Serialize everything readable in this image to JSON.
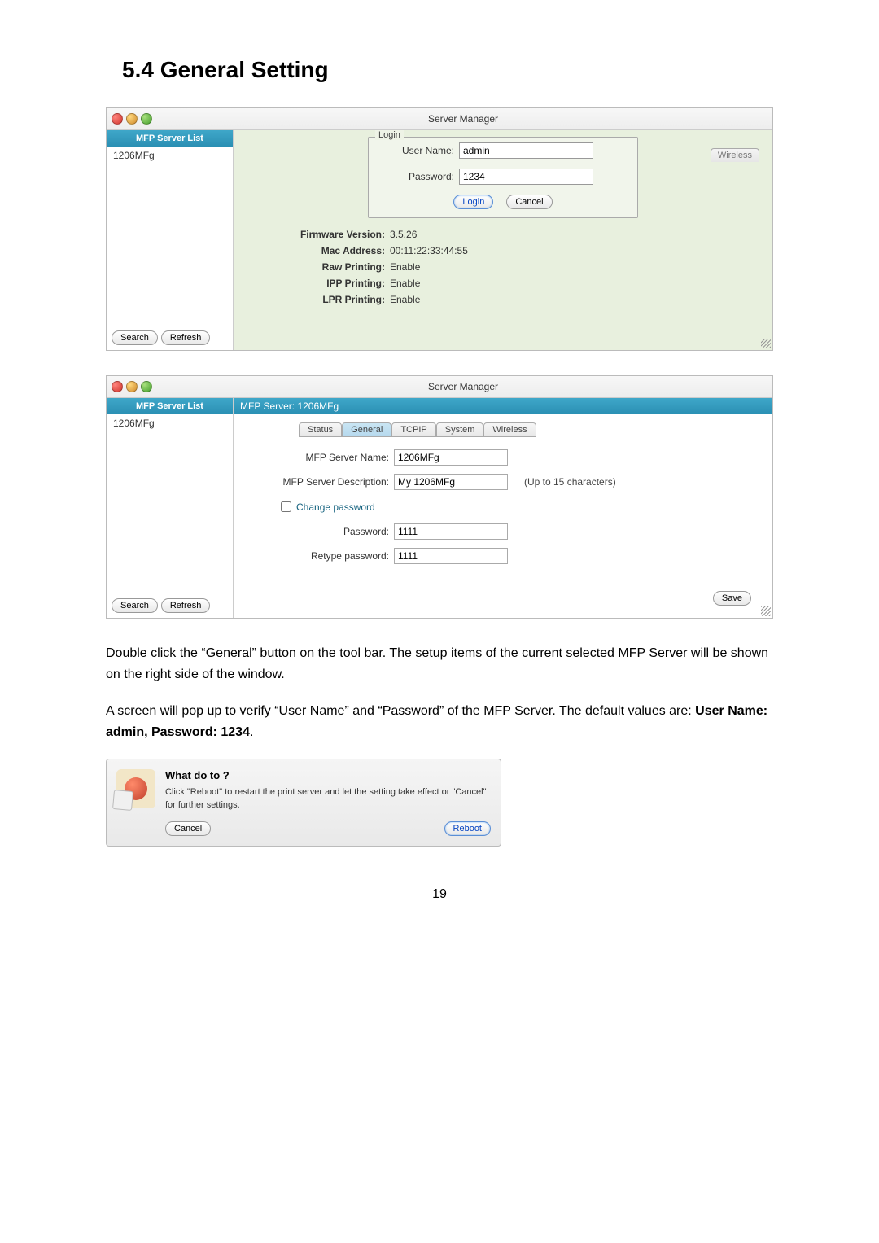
{
  "heading": "5.4   General Setting",
  "window_title": "Server Manager",
  "sidebar_header": "MFP Server List",
  "sidebar_item": "1206MFg",
  "search_btn": "Search",
  "refresh_btn": "Refresh",
  "screenshot1": {
    "login_legend": "Login",
    "username_label": "User Name:",
    "username_value": "admin",
    "password_label": "Password:",
    "password_value": "1234",
    "login_btn": "Login",
    "cancel_btn": "Cancel",
    "wireless_tab": "Wireless",
    "info": {
      "firmware_lbl": "Firmware Version:",
      "firmware_val": "3.5.26",
      "mac_lbl": "Mac Address:",
      "mac_val": "00:11:22:33:44:55",
      "raw_lbl": "Raw Printing:",
      "raw_val": "Enable",
      "ipp_lbl": "IPP Printing:",
      "ipp_val": "Enable",
      "lpr_lbl": "LPR Printing:",
      "lpr_val": "Enable"
    }
  },
  "screenshot2": {
    "header_bar": "MFP Server: 1206MFg",
    "tabs": {
      "status": "Status",
      "general": "General",
      "tcpip": "TCPIP",
      "system": "System",
      "wireless": "Wireless"
    },
    "name_lbl": "MFP Server Name:",
    "name_val": "1206MFg",
    "desc_lbl": "MFP Server Description:",
    "desc_val": "My 1206MFg",
    "desc_hint": "(Up to 15 characters)",
    "change_pw": "Change password",
    "pw_lbl": "Password:",
    "pw_val": "1111",
    "rpw_lbl": "Retype password:",
    "rpw_val": "1111",
    "save_btn": "Save"
  },
  "paragraph1": "Double click the “General” button on the tool bar. The setup items of the current selected MFP Server will be shown on the right side of the window.",
  "paragraph2a": "A screen will pop up to verify “User Name” and “Password” of the MFP Server. The default values are: ",
  "paragraph2b": "User Name: admin, Password: 1234",
  "dialog": {
    "title": "What do to ?",
    "body": "Click \"Reboot\" to restart the print server and let the setting take effect or \"Cancel\" for further settings.",
    "cancel": "Cancel",
    "reboot": "Reboot"
  },
  "page_number": "19"
}
